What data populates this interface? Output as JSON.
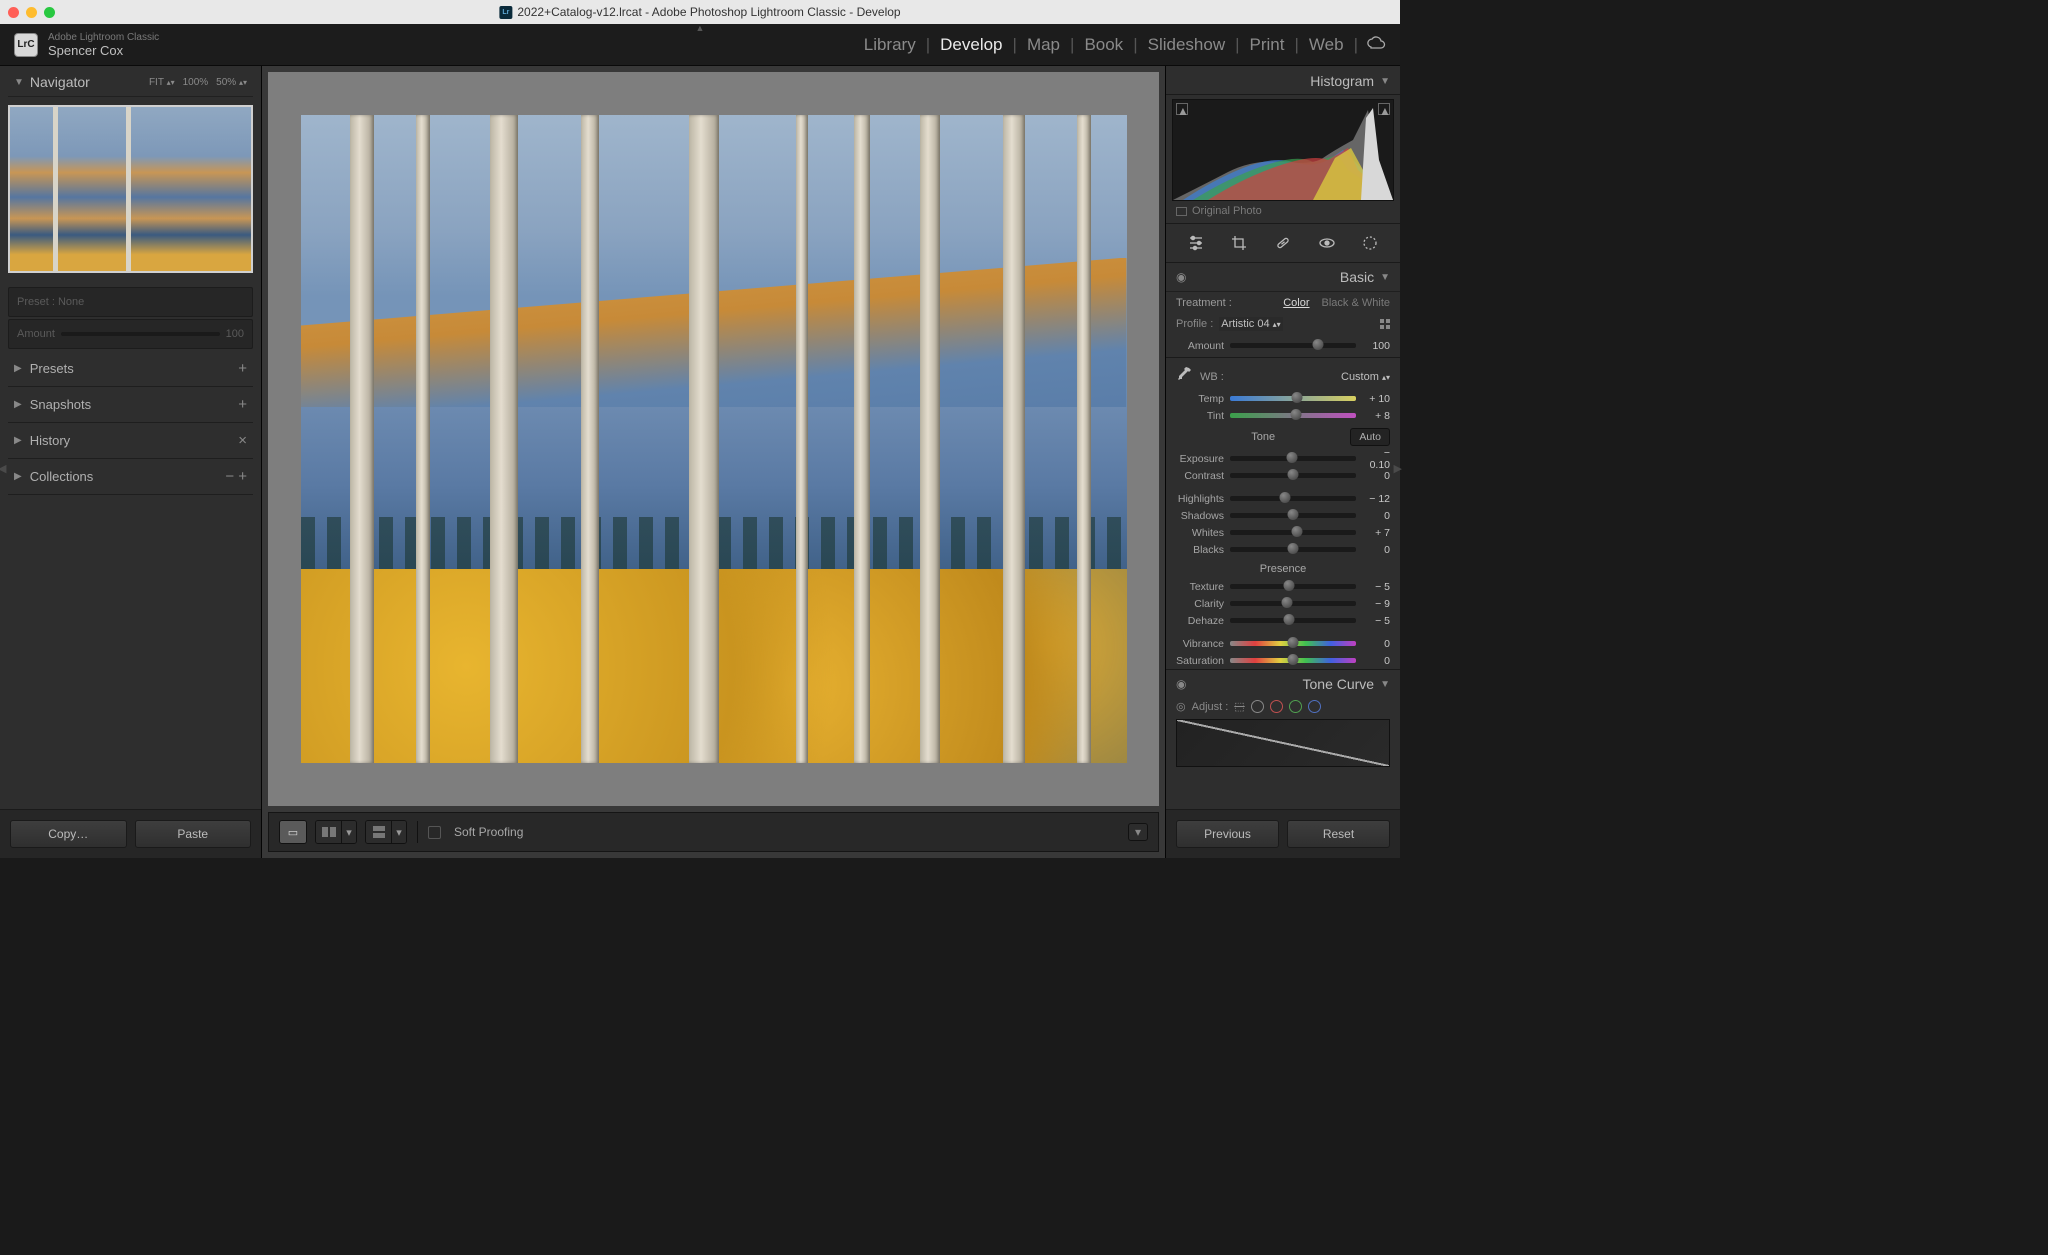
{
  "window": {
    "title": "2022+Catalog-v12.lrcat - Adobe Photoshop Lightroom Classic - Develop"
  },
  "header": {
    "app_name": "Adobe Lightroom Classic",
    "user_name": "Spencer Cox",
    "logo_text": "LrC",
    "modules": [
      "Library",
      "Develop",
      "Map",
      "Book",
      "Slideshow",
      "Print",
      "Web"
    ],
    "active_module": "Develop"
  },
  "left": {
    "navigator": {
      "title": "Navigator",
      "zoom_options": [
        "FIT",
        "100%",
        "50%"
      ],
      "zoom_active": "FIT"
    },
    "preset_preview": {
      "label": "Preset : None",
      "amount_label": "Amount",
      "amount_value": "100"
    },
    "panels": [
      {
        "name": "Presets",
        "action": "+"
      },
      {
        "name": "Snapshots",
        "action": "+"
      },
      {
        "name": "History",
        "action": "×"
      },
      {
        "name": "Collections",
        "action": "− +"
      }
    ],
    "footer": {
      "copy": "Copy…",
      "paste": "Paste"
    }
  },
  "toolbar": {
    "soft_proofing": "Soft Proofing"
  },
  "right": {
    "histogram": {
      "title": "Histogram",
      "original_label": "Original Photo"
    },
    "tools": [
      "edit-sliders-icon",
      "crop-icon",
      "healing-icon",
      "redeye-icon",
      "masking-icon"
    ],
    "basic": {
      "title": "Basic",
      "treatment_label": "Treatment :",
      "treatment": {
        "color": "Color",
        "bw": "Black & White",
        "selected": "Color"
      },
      "profile_label": "Profile :",
      "profile_value": "Artistic 04",
      "amount_label": "Amount",
      "amount_value": "100",
      "wb_label": "WB :",
      "wb_value": "Custom",
      "temp": {
        "label": "Temp",
        "value": "+ 10",
        "pos": 53
      },
      "tint": {
        "label": "Tint",
        "value": "+ 8",
        "pos": 52
      },
      "tone_label": "Tone",
      "auto_label": "Auto",
      "exposure": {
        "label": "Exposure",
        "value": "− 0.10",
        "pos": 49
      },
      "contrast": {
        "label": "Contrast",
        "value": "0",
        "pos": 50
      },
      "highlights": {
        "label": "Highlights",
        "value": "− 12",
        "pos": 44
      },
      "shadows": {
        "label": "Shadows",
        "value": "0",
        "pos": 50
      },
      "whites": {
        "label": "Whites",
        "value": "+ 7",
        "pos": 53
      },
      "blacks": {
        "label": "Blacks",
        "value": "0",
        "pos": 50
      },
      "presence_label": "Presence",
      "texture": {
        "label": "Texture",
        "value": "− 5",
        "pos": 47
      },
      "clarity": {
        "label": "Clarity",
        "value": "− 9",
        "pos": 45
      },
      "dehaze": {
        "label": "Dehaze",
        "value": "− 5",
        "pos": 47
      },
      "vibrance": {
        "label": "Vibrance",
        "value": "0",
        "pos": 50
      },
      "saturation": {
        "label": "Saturation",
        "value": "0",
        "pos": 50
      }
    },
    "tone_curve": {
      "title": "Tone Curve",
      "adjust_label": "Adjust :"
    },
    "footer": {
      "previous": "Previous",
      "reset": "Reset"
    }
  }
}
